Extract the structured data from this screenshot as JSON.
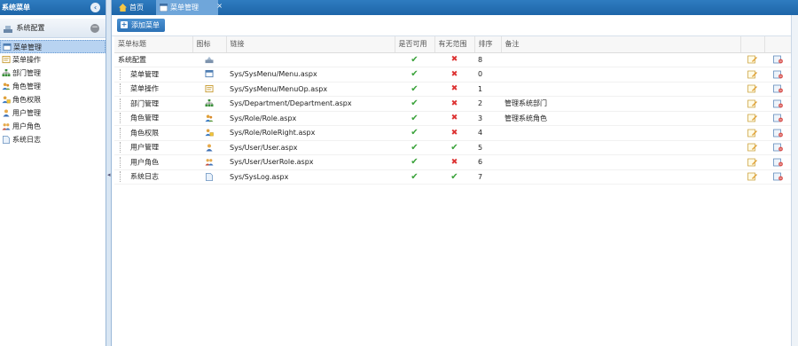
{
  "sidebar": {
    "title": "系统菜单",
    "group": "系统配置",
    "items": [
      {
        "label": "菜单管理",
        "icon": "window-icon",
        "active": true
      },
      {
        "label": "菜单操作",
        "icon": "form-icon",
        "active": false
      },
      {
        "label": "部门管理",
        "icon": "org-chart-icon",
        "active": false
      },
      {
        "label": "角色管理",
        "icon": "role-users-icon",
        "active": false
      },
      {
        "label": "角色权限",
        "icon": "role-key-icon",
        "active": false
      },
      {
        "label": "用户管理",
        "icon": "user-icon",
        "active": false
      },
      {
        "label": "用户角色",
        "icon": "user-group-icon",
        "active": false
      },
      {
        "label": "系统日志",
        "icon": "document-icon",
        "active": false
      }
    ]
  },
  "tabs": [
    {
      "label": "首页",
      "icon": "home-icon"
    },
    {
      "label": "菜单管理",
      "icon": "window-icon"
    }
  ],
  "toolbar": {
    "add_label": "添加菜单"
  },
  "grid": {
    "columns": [
      "菜单标题",
      "图标",
      "链接",
      "是否可用",
      "有无范围",
      "排序",
      "备注"
    ],
    "rows": [
      {
        "title": "系统配置",
        "icon": "config-icon",
        "link": "",
        "enabled": true,
        "scoped": false,
        "sort": "8",
        "remark": "",
        "child": false
      },
      {
        "title": "菜单管理",
        "icon": "window-icon",
        "link": "Sys/SysMenu/Menu.aspx",
        "enabled": true,
        "scoped": false,
        "sort": "0",
        "remark": "",
        "child": true
      },
      {
        "title": "菜单操作",
        "icon": "form-icon",
        "link": "Sys/SysMenu/MenuOp.aspx",
        "enabled": true,
        "scoped": false,
        "sort": "1",
        "remark": "",
        "child": true
      },
      {
        "title": "部门管理",
        "icon": "org-chart-icon",
        "link": "Sys/Department/Department.aspx",
        "enabled": true,
        "scoped": false,
        "sort": "2",
        "remark": "管理系统部门",
        "child": true
      },
      {
        "title": "角色管理",
        "icon": "role-users-icon",
        "link": "Sys/Role/Role.aspx",
        "enabled": true,
        "scoped": false,
        "sort": "3",
        "remark": "管理系统角色",
        "child": true
      },
      {
        "title": "角色权限",
        "icon": "role-key-icon",
        "link": "Sys/Role/RoleRight.aspx",
        "enabled": true,
        "scoped": false,
        "sort": "4",
        "remark": "",
        "child": true
      },
      {
        "title": "用户管理",
        "icon": "user-icon",
        "link": "Sys/User/User.aspx",
        "enabled": true,
        "scoped": true,
        "sort": "5",
        "remark": "",
        "child": true
      },
      {
        "title": "用户角色",
        "icon": "user-group-icon",
        "link": "Sys/User/UserRole.aspx",
        "enabled": true,
        "scoped": false,
        "sort": "6",
        "remark": "",
        "child": true
      },
      {
        "title": "系统日志",
        "icon": "document-icon",
        "link": "Sys/SysLog.aspx",
        "enabled": true,
        "scoped": true,
        "sort": "7",
        "remark": "",
        "child": true
      }
    ]
  },
  "colors": {
    "header": "#1d65a8",
    "active_tab": "#6fa6da",
    "check": "#3aa23a",
    "cross": "#dd3333"
  }
}
